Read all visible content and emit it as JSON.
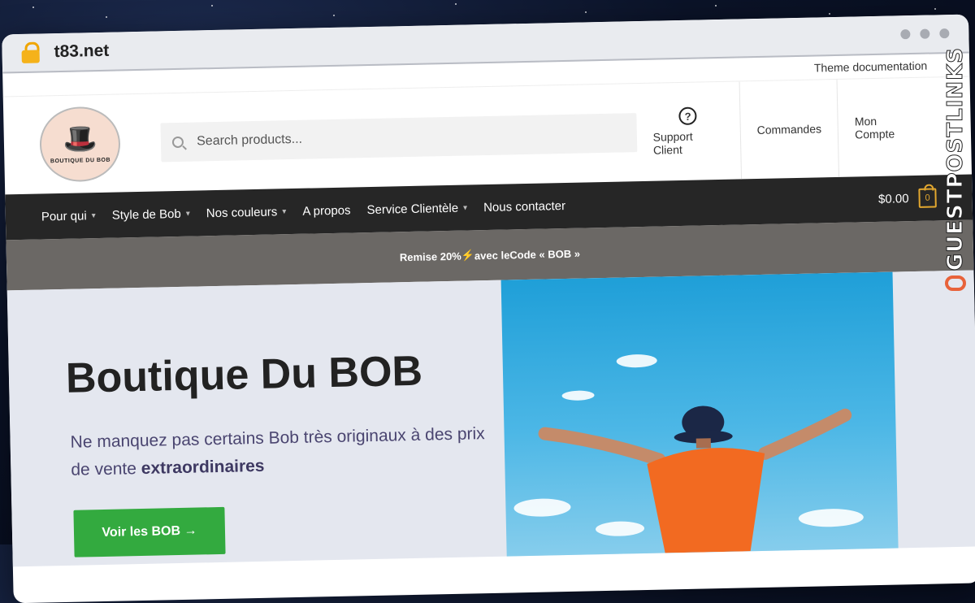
{
  "browser": {
    "url": "t83.net"
  },
  "topbar": {
    "theme_doc": "Theme documentation"
  },
  "header": {
    "logo_text": "BOUTIQUE DU BOB",
    "search_placeholder": "Search products...",
    "links": [
      "Support Client",
      "Commandes",
      "Mon Compte"
    ]
  },
  "nav": {
    "items": [
      "Pour qui",
      "Style de Bob",
      "Nos couleurs",
      "A propos",
      "Service Clientèle",
      "Nous contacter"
    ],
    "cart_total": "$0.00",
    "cart_count": "0"
  },
  "promo": {
    "text_before": "Remise 20%",
    "bolt": "⚡",
    "text_after": "avec leCode « BOB »"
  },
  "hero": {
    "title": "Boutique Du BOB",
    "subtitle_start": "Ne manquez pas certains Bob très originaux à des prix de vente ",
    "subtitle_bold": "extraordinaires",
    "cta": "Voir les BOB →"
  },
  "watermark": {
    "text": "GUESTPOSTLINKS"
  }
}
